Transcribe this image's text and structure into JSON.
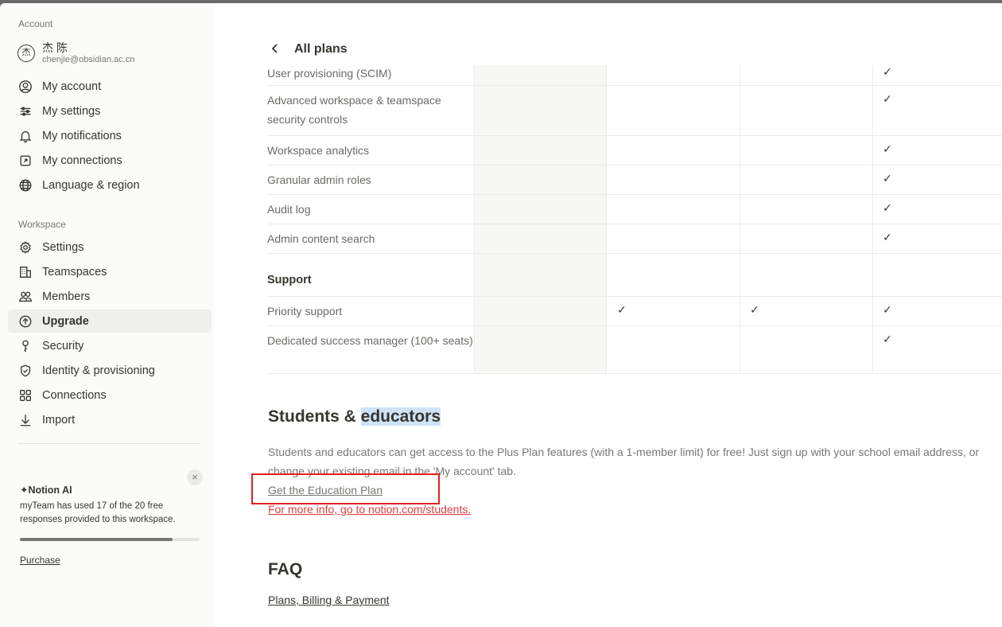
{
  "sidebar": {
    "account_label": "Account",
    "user": {
      "avatar_char": "杰",
      "name": "杰 陈",
      "email": "chenjie@obsidian.ac.cn"
    },
    "account_items": [
      {
        "label": "My account",
        "icon": "user-circle-icon"
      },
      {
        "label": "My settings",
        "icon": "sliders-icon"
      },
      {
        "label": "My notifications",
        "icon": "bell-icon"
      },
      {
        "label": "My connections",
        "icon": "external-link-icon"
      },
      {
        "label": "Language & region",
        "icon": "globe-icon"
      }
    ],
    "workspace_label": "Workspace",
    "workspace_items": [
      {
        "label": "Settings",
        "icon": "gear-icon"
      },
      {
        "label": "Teamspaces",
        "icon": "building-icon"
      },
      {
        "label": "Members",
        "icon": "members-icon"
      },
      {
        "label": "Upgrade",
        "icon": "upgrade-icon",
        "active": true
      },
      {
        "label": "Security",
        "icon": "key-icon"
      },
      {
        "label": "Identity & provisioning",
        "icon": "shield-icon"
      },
      {
        "label": "Connections",
        "icon": "grid-icon"
      },
      {
        "label": "Import",
        "icon": "download-icon"
      }
    ],
    "ai_card": {
      "title": "Notion AI",
      "close": "×",
      "text": "myTeam has used 17 of the 20 free responses provided to this workspace.",
      "used": 17,
      "total": 20,
      "purchase": "Purchase"
    }
  },
  "main": {
    "back_title": "All plans",
    "back_icon": "chevron-left-icon",
    "check_glyph": "✓",
    "rows": [
      {
        "feature": "User provisioning (SCIM)",
        "checks": [
          false,
          false,
          true
        ]
      },
      {
        "feature": "Advanced workspace & teamspace security controls",
        "checks": [
          false,
          false,
          true
        ]
      },
      {
        "feature": "Workspace analytics",
        "checks": [
          false,
          false,
          true
        ]
      },
      {
        "feature": "Granular admin roles",
        "checks": [
          false,
          false,
          true
        ]
      },
      {
        "feature": "Audit log",
        "checks": [
          false,
          false,
          true
        ]
      },
      {
        "feature": "Admin content search",
        "checks": [
          false,
          false,
          true
        ]
      }
    ],
    "support_heading": "Support",
    "support_rows": [
      {
        "feature": "Priority support",
        "checks": [
          true,
          true,
          true
        ]
      },
      {
        "feature": "Dedicated success manager (100+ seats)",
        "checks": [
          false,
          false,
          true
        ]
      }
    ],
    "students": {
      "heading_part1": "Students & ",
      "heading_part2": "educators",
      "text": "Students and educators can get access to the Plus Plan features (with a 1-member limit) for free! Just sign up with your school email address, or change your existing email in the 'My account' tab.",
      "link": "Get the Education Plan",
      "info_link": "For more info, go to notion.com/students."
    },
    "faq": {
      "heading": "FAQ",
      "link": "Plans, Billing & Payment"
    }
  },
  "colors": {
    "sidebar_bg": "#fbfbfa",
    "highlight": "#cfe3f7",
    "annotation_box": "#e0201e",
    "link_red": "#e03e3e"
  }
}
